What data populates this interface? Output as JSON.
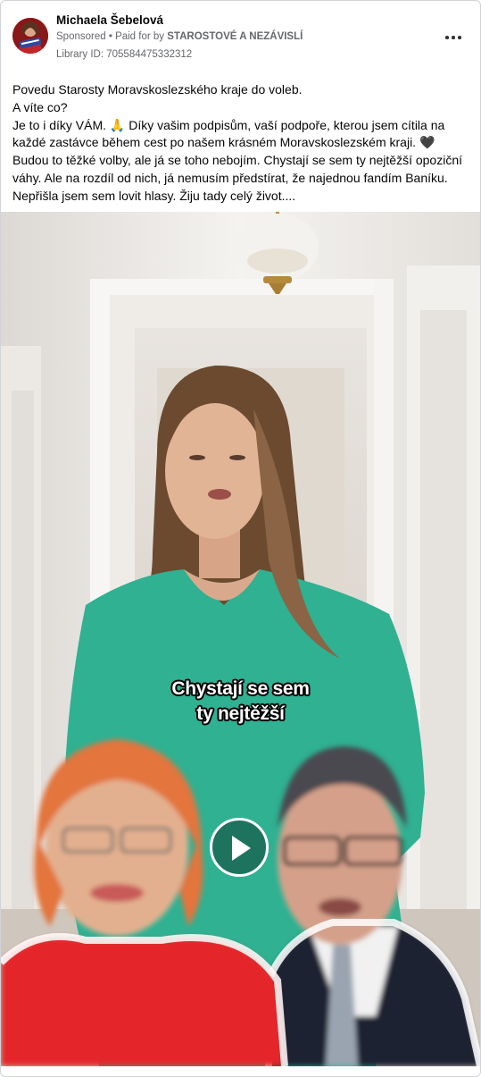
{
  "post": {
    "author": "Michaela Šebelová",
    "sponsored_label": "Sponsored",
    "paid_prefix": "Paid for by",
    "payer": "STAROSTOVÉ A NEZÁVISLÍ",
    "library_id": "Library ID: 705584475332312",
    "more_icon": "more-options-icon",
    "text_lines": [
      "Povedu Starosty Moravskoslezského kraje do voleb.",
      "A víte co?",
      "Je to i díky VÁM. 🙏 Díky vašim podpisům, vaší podpoře, kterou jsem cítila na",
      "každé zastávce během cest po našem krásném Moravskoslezském kraji. 🖤",
      "Budou to těžké volby, ale já se toho nebojím. Chystají se sem ty nejtěžší opoziční",
      "váhy. Ale na rozdíl od nich, já nemusím předstírat, že najednou fandím Baníku.",
      "Nepřišla jsem sem lovit hlasy. Žiju tady celý život...."
    ]
  },
  "video": {
    "caption_line1": "Chystají se sem",
    "caption_line2": "ty nejtěžší",
    "play_icon": "play-icon"
  },
  "colors": {
    "dress": "#2fb192",
    "wall": "#f3f1ee",
    "red_top": "#e4262b",
    "suit": "#1f2433"
  }
}
